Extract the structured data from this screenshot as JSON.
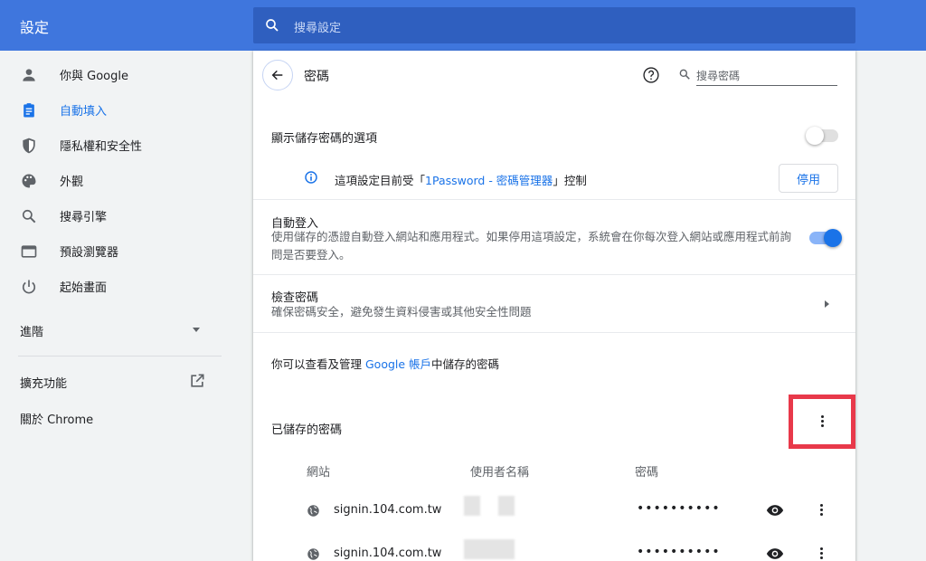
{
  "header": {
    "title": "設定",
    "search_placeholder": "搜尋設定",
    "colors": {
      "bar": "#3f76dd",
      "search_bg": "#2f5fbf"
    }
  },
  "sidebar": {
    "items": [
      {
        "label": "你與 Google",
        "icon": "person-icon",
        "active": false
      },
      {
        "label": "自動填入",
        "icon": "clipboard-icon",
        "active": true
      },
      {
        "label": "隱私權和安全性",
        "icon": "shield-icon",
        "active": false
      },
      {
        "label": "外觀",
        "icon": "palette-icon",
        "active": false
      },
      {
        "label": "搜尋引擎",
        "icon": "search-icon",
        "active": false
      },
      {
        "label": "預設瀏覽器",
        "icon": "browser-icon",
        "active": false
      },
      {
        "label": "起始畫面",
        "icon": "power-icon",
        "active": false
      }
    ],
    "advanced_label": "進階",
    "extensions_label": "擴充功能",
    "about_label": "關於 Chrome",
    "accent_color": "#1a73e8"
  },
  "passwords": {
    "title": "密碼",
    "search_placeholder": "搜尋密碼",
    "offer_to_save": {
      "label": "顯示儲存密碼的選項",
      "enabled": false
    },
    "managed_notice": {
      "prefix": "這項設定目前受「",
      "link": "1Password - 密碼管理器",
      "suffix": "」控制"
    },
    "disable_button": "停用",
    "auto_signin": {
      "label": "自動登入",
      "description": "使用儲存的憑證自動登入網站和應用程式。如果停用這項設定，系統會在你每次登入網站或應用程式前詢問是否要登入。",
      "enabled": true
    },
    "check": {
      "label": "檢查密碼",
      "description": "確保密碼安全，避免發生資料侵害或其他安全性問題"
    },
    "google_account": {
      "prefix": "你可以查看及管理 ",
      "link": "Google 帳戶",
      "suffix": "中儲存的密碼"
    },
    "saved_title": "已儲存的密碼",
    "columns": [
      "網站",
      "使用者名稱",
      "密碼"
    ],
    "rows": [
      {
        "site": "signin.104.com.tw",
        "password": "••••••••••"
      },
      {
        "site": "signin.104.com.tw",
        "password": "••••••••••"
      }
    ],
    "highlight_color": "#e8394a"
  }
}
